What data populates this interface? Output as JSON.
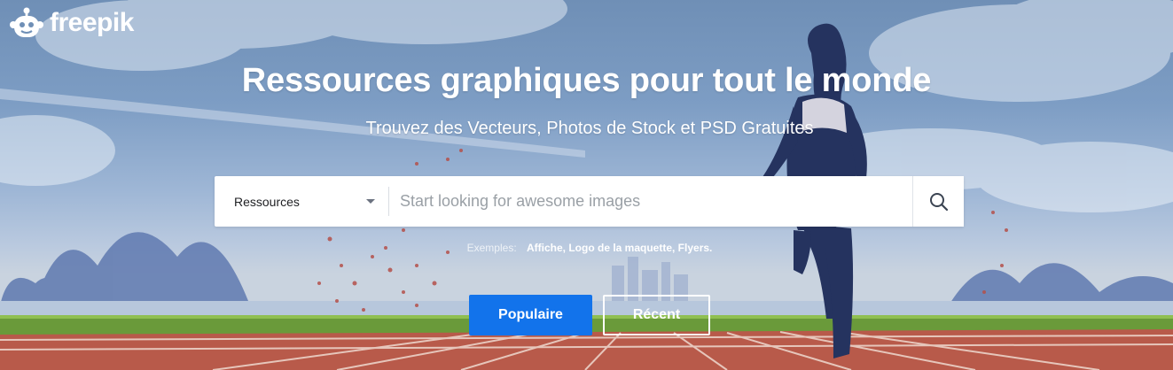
{
  "brand": {
    "name": "freepik"
  },
  "hero": {
    "title": "Ressources graphiques pour tout le monde",
    "subtitle": "Trouvez des Vecteurs, Photos de Stock et PSD Gratuites"
  },
  "search": {
    "type_selected": "Ressources",
    "placeholder": "Start looking for awesome images",
    "value": ""
  },
  "examples": {
    "label": "Exemples:",
    "items": "Affiche, Logo de la maquette, Flyers."
  },
  "tabs": {
    "popular_label": "Populaire",
    "recent_label": "Récent"
  },
  "colors": {
    "primary": "#1273eb",
    "text_on_hero": "#ffffff",
    "track": "#b85a4a",
    "grass": "#6a9a3a"
  },
  "icons": {
    "logo": "freepik-robot-logo-icon",
    "dropdown": "chevron-down-icon",
    "search": "search-icon"
  }
}
